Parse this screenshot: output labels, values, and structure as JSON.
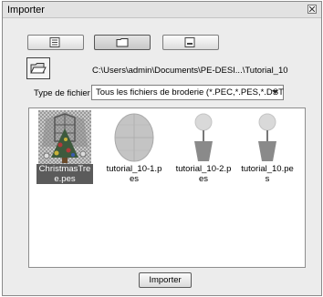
{
  "window": {
    "title": "Importer",
    "close_icon": "close-icon"
  },
  "view_buttons": [
    {
      "name": "list-view",
      "icon": "list-view-icon",
      "selected": false
    },
    {
      "name": "folder-view",
      "icon": "folder-icon",
      "selected": true
    },
    {
      "name": "thumbnail-view",
      "icon": "thumbnail-icon",
      "selected": false
    }
  ],
  "folder_button": {
    "icon": "open-folder-icon"
  },
  "path": "C:\\Users\\admin\\Documents\\PE-DESI...\\Tutorial_10",
  "file_type": {
    "label": "Type de fichier",
    "selected": "Tous les fichiers de broderie (*.PEC,*.PES,*.DST"
  },
  "files": [
    {
      "name": "ChristmasTree.pes",
      "thumbnail": "christmas-tree",
      "selected": true
    },
    {
      "name": "tutorial_10-1.pes",
      "thumbnail": "oval",
      "selected": false
    },
    {
      "name": "tutorial_10-2.pes",
      "thumbnail": "flower-pot",
      "selected": false
    },
    {
      "name": "tutorial_10.pes",
      "thumbnail": "flower-pot",
      "selected": false
    }
  ],
  "import_button": {
    "label": "Importer"
  },
  "colors": {
    "selection": "#5b5b5b",
    "dialog_bg": "#ececec"
  }
}
